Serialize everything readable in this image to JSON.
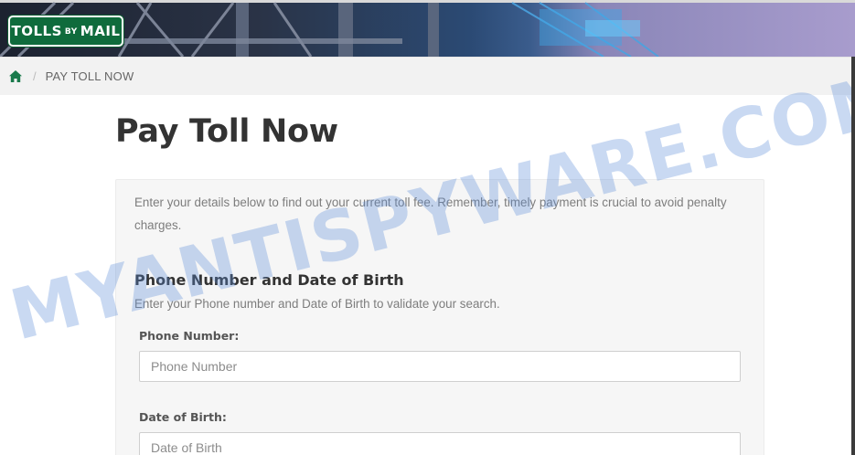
{
  "header": {
    "logo": {
      "part1": "TOLLS",
      "part2": "BY",
      "part3": "MAIL"
    }
  },
  "breadcrumb": {
    "home_icon": "home-icon",
    "separator": "/",
    "current": "PAY TOLL NOW"
  },
  "page": {
    "title": "Pay Toll Now",
    "intro": "Enter your details below to find out your current toll fee. Remember, timely payment is crucial to avoid penalty charges."
  },
  "form": {
    "section_title": "Phone Number and Date of Birth",
    "section_subtitle": "Enter your Phone number and Date of Birth to validate your search.",
    "phone": {
      "label": "Phone Number:",
      "placeholder": "Phone Number",
      "value": ""
    },
    "dob": {
      "label": "Date of Birth:",
      "placeholder": "Date of Birth",
      "value": ""
    }
  },
  "watermark": "MYANTISPYWARE.COM",
  "colors": {
    "logo_green": "#0f6b3c",
    "home_icon_green": "#1a7a4c",
    "watermark_blue": "#5a8cd7"
  }
}
